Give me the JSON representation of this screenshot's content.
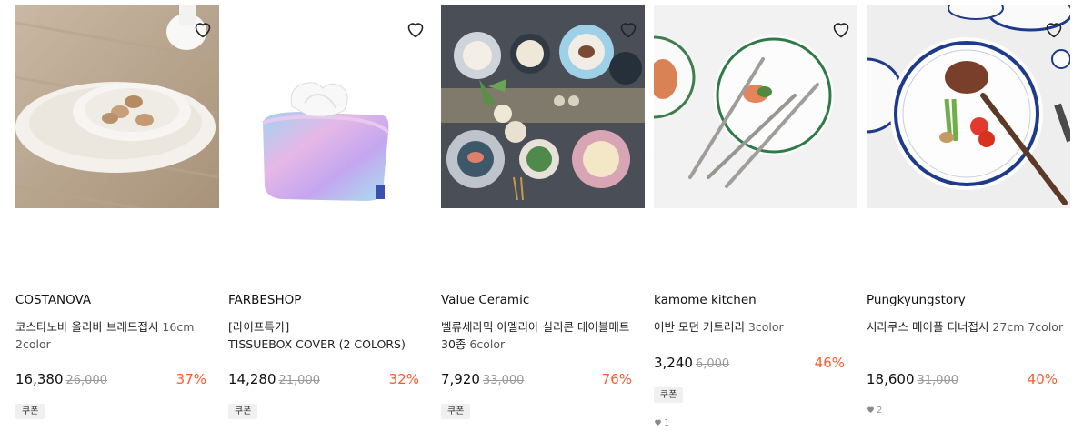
{
  "products": [
    {
      "brand": "COSTANOVA",
      "title": "코스타노바 올리바 브래드접시",
      "option": " 16cm 2color",
      "price": "16,380",
      "original": "26,000",
      "discount": "37%",
      "coupon": "쿠폰",
      "likes": null,
      "image_icon": "bread-plate-photo"
    },
    {
      "brand": "FARBESHOP",
      "title": "[라이프특가]",
      "option": "TISSUEBOX COVER (2 COLORS)",
      "price": "14,280",
      "original": "21,000",
      "discount": "32%",
      "coupon": "쿠폰",
      "likes": null,
      "image_icon": "tissue-box-photo"
    },
    {
      "brand": "Value Ceramic",
      "title": "벨류세라믹 아멜리아 실리콘 테이블매트 30종",
      "option": " 6color",
      "price": "7,920",
      "original": "33,000",
      "discount": "76%",
      "coupon": "쿠폰",
      "likes": null,
      "image_icon": "table-mat-photo"
    },
    {
      "brand": "kamome kitchen",
      "title": "어반 모던 커트러리",
      "option": " 3color",
      "price": "3,240",
      "original": "6,000",
      "discount": "46%",
      "coupon": "쿠폰",
      "likes": "1",
      "image_icon": "cutlery-photo"
    },
    {
      "brand": "Pungkyungstory",
      "title": "시라쿠스 메이플 디너접시",
      "option": " 27cm 7color",
      "price": "18,600",
      "original": "31,000",
      "discount": "40%",
      "coupon": null,
      "likes": "2",
      "image_icon": "dinner-plate-photo"
    }
  ]
}
